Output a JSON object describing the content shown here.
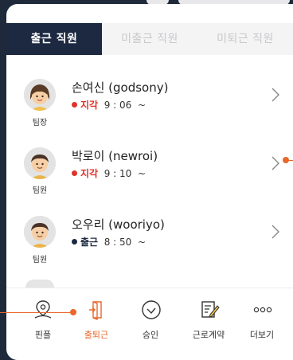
{
  "tabs": [
    {
      "label": "출근 직원",
      "active": true
    },
    {
      "label": "미출근 직원",
      "active": false
    },
    {
      "label": "미퇴근 직원",
      "active": false
    }
  ],
  "employees": [
    {
      "name": "손여신 (godsony)",
      "role": "팀장",
      "state": "지각",
      "time": "9 : 06  ~",
      "state_color": "#e0312b",
      "avatar": "female-avatar-icon"
    },
    {
      "name": "박로이 (newroi)",
      "role": "팀원",
      "state": "지각",
      "time": "9 : 10  ~",
      "state_color": "#e0312b",
      "avatar": "male-avatar-icon"
    },
    {
      "name": "오우리 (wooriyo)",
      "role": "팀원",
      "state": "출근",
      "time": "8 : 50  ~",
      "state_color": "#1c2940",
      "avatar": "male-avatar-icon"
    }
  ],
  "nav": [
    {
      "label": "핀플",
      "icon": "map-pin-icon",
      "active": false
    },
    {
      "label": "출퇴근",
      "icon": "door-exit-icon",
      "active": true
    },
    {
      "label": "승인",
      "icon": "check-circle-icon",
      "active": false
    },
    {
      "label": "근로계약",
      "icon": "contract-document-icon",
      "active": false
    },
    {
      "label": "더보기",
      "icon": "more-dots-icon",
      "active": false
    }
  ],
  "colors": {
    "accent": "#e8672a",
    "navy": "#1c2940",
    "late": "#e0312b",
    "background": "#1e2a3a"
  }
}
